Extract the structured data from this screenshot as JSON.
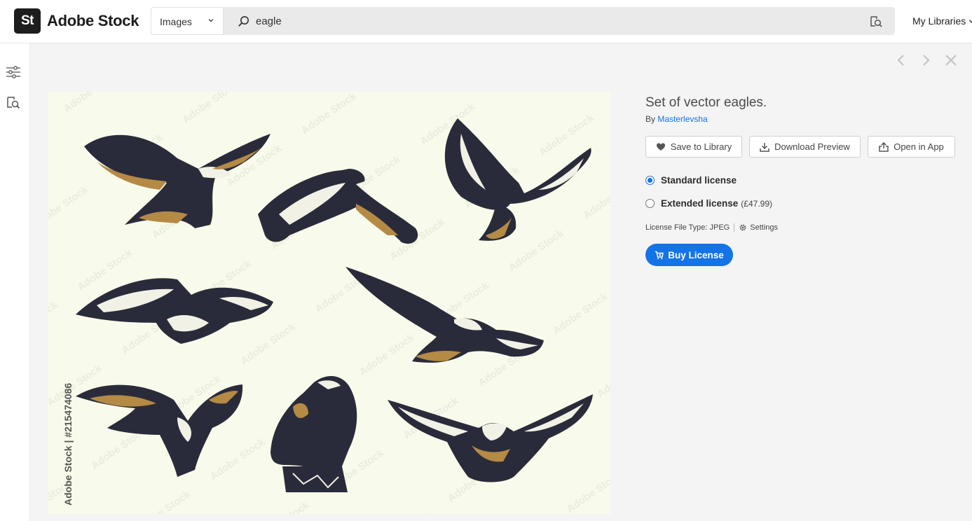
{
  "header": {
    "logo_text": "St",
    "brand": "Adobe Stock",
    "search_type": "Images",
    "search_value": "eagle",
    "my_libraries": "My Libraries"
  },
  "asset": {
    "title": "Set of vector eagles.",
    "by_label": "By",
    "author": "Masterlevsha",
    "stock_id": "Adobe Stock | #215474086",
    "watermark": "Adobe Stock"
  },
  "actions": {
    "save": "Save to Library",
    "download": "Download Preview",
    "open": "Open in App"
  },
  "licenses": [
    {
      "label": "Standard license",
      "price": "",
      "selected": true
    },
    {
      "label": "Extended license",
      "price": "(£47.99)",
      "selected": false
    }
  ],
  "file": {
    "type_label": "License File Type: JPEG",
    "settings": "Settings"
  },
  "buy": "Buy License",
  "colors": {
    "accent": "#1473e6",
    "preview_bg": "#f8fbeb",
    "eagle_dark": "#2a2b3a",
    "eagle_gold": "#b48a45"
  }
}
